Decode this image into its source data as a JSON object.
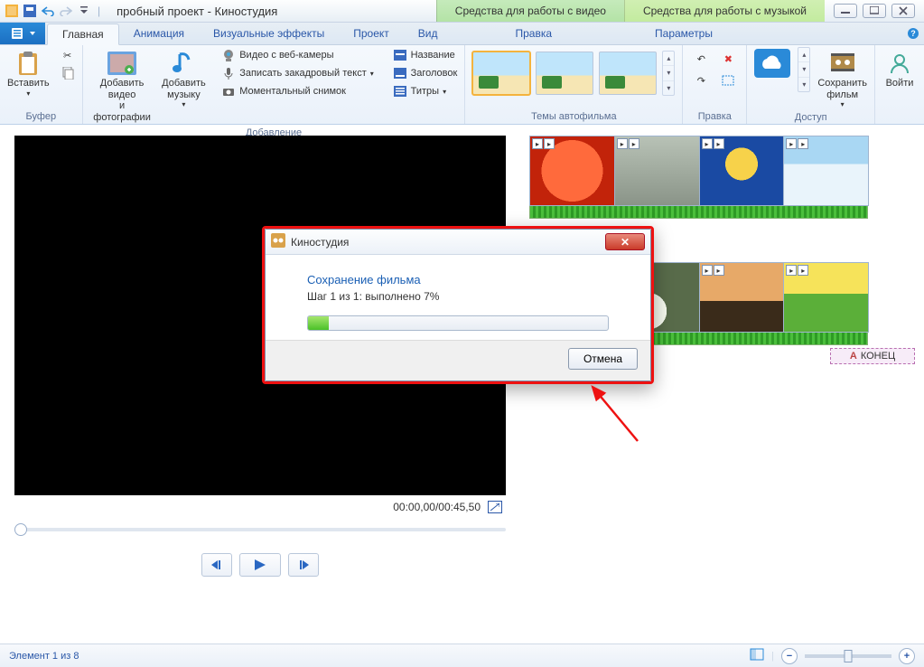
{
  "title": "пробный проект - Киностудия",
  "context_tabs": {
    "video": "Средства для работы с видео",
    "music": "Средства для работы с музыкой"
  },
  "tabs": {
    "home": "Главная",
    "animation": "Анимация",
    "vfx": "Визуальные эффекты",
    "project": "Проект",
    "view": "Вид",
    "edit": "Правка",
    "params": "Параметры"
  },
  "ribbon": {
    "buffer": {
      "label": "Буфер",
      "paste": "Вставить"
    },
    "add": {
      "label": "Добавление",
      "add_video": "Добавить видео\nи фотографии",
      "add_music": "Добавить\nмузыку",
      "webcam": "Видео с веб-камеры",
      "voiceover": "Записать закадровый текст",
      "snapshot": "Моментальный снимок",
      "title": "Название",
      "caption": "Заголовок",
      "credits": "Титры"
    },
    "themes": {
      "label": "Темы автофильма"
    },
    "edit": {
      "label": "Правка"
    },
    "access": {
      "label": "Доступ",
      "save_movie": "Сохранить\nфильм",
      "signin": "Войти"
    }
  },
  "preview": {
    "time": "00:00,00/00:45,50"
  },
  "timeline": {
    "end": "КОНЕЦ"
  },
  "status": {
    "text": "Элемент 1 из 8"
  },
  "modal": {
    "title": "Киностудия",
    "heading": "Сохранение фильма",
    "step": "Шаг 1 из 1: выполнено 7%",
    "cancel": "Отмена"
  }
}
